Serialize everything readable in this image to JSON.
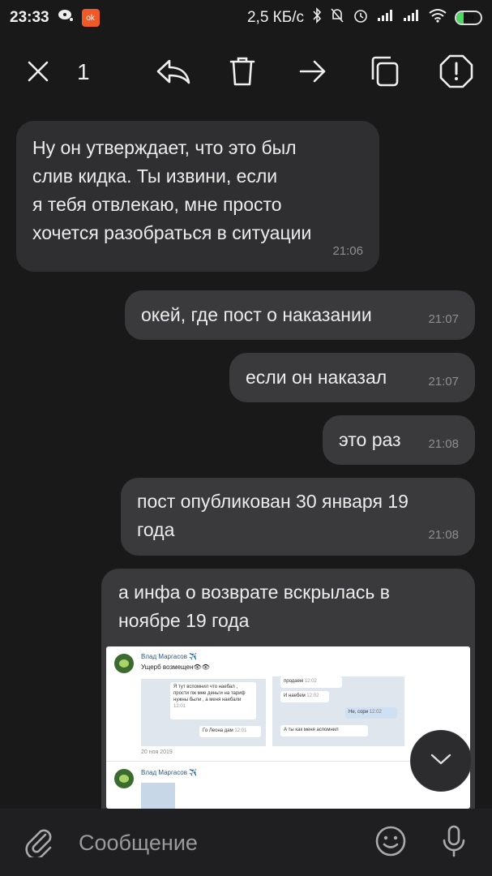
{
  "status_bar": {
    "time": "23:33",
    "net_speed": "2,5 КБ/с",
    "battery": "29",
    "battery_level": 0.29
  },
  "toolbar": {
    "selected_count": "1"
  },
  "messages": [
    {
      "direction": "in",
      "lines": [
        "Ну он утверждает, что это был",
        "слив кидка. Ты извини, если",
        "я тебя отвлекаю, мне просто",
        "хочется разобраться в ситуации"
      ],
      "time": "21:06"
    },
    {
      "direction": "out",
      "lines": [
        "окей, где пост о наказании"
      ],
      "time": "21:07"
    },
    {
      "direction": "out",
      "lines": [
        "если он наказал"
      ],
      "time": "21:07"
    },
    {
      "direction": "out",
      "lines": [
        "это раз"
      ],
      "time": "21:08"
    },
    {
      "direction": "out",
      "lines": [
        "пост опубликован 30 января 19",
        "года"
      ],
      "time": "21:08"
    },
    {
      "direction": "out",
      "lines": [
        "а инфа о возврате вскрылась в",
        "ноябре 19 года"
      ],
      "time": ""
    }
  ],
  "attachment": {
    "author1": "Влад Маргасов ✈️",
    "post1_text": "Ущерб возмещен👁👁",
    "chat_left_1": "Я тут вспомнил что наебал , прости пж мне деньги на тариф нужны были , а меня наебали",
    "chat_left_1_time": "12:01",
    "chat_left_2": "Го Леона дам",
    "chat_left_2_time": "12:01",
    "chat_right_1": "продаем",
    "chat_right_1_time": "12:02",
    "chat_right_2": "И наебем",
    "chat_right_2_time": "12:02",
    "chat_right_3": "Не, сори",
    "chat_right_3_time": "12:02",
    "chat_right_4": "А ты как меня аспомнил",
    "date1": "20 ноя 2019",
    "author2": "Влад Маргасов ✈️"
  },
  "composer": {
    "placeholder": "Сообщение"
  },
  "icons": [
    "close-icon",
    "reply-icon",
    "trash-icon",
    "forward-icon",
    "copy-icon",
    "report-icon",
    "scroll-down-icon",
    "attach-icon",
    "emoji-icon",
    "mic-icon"
  ]
}
